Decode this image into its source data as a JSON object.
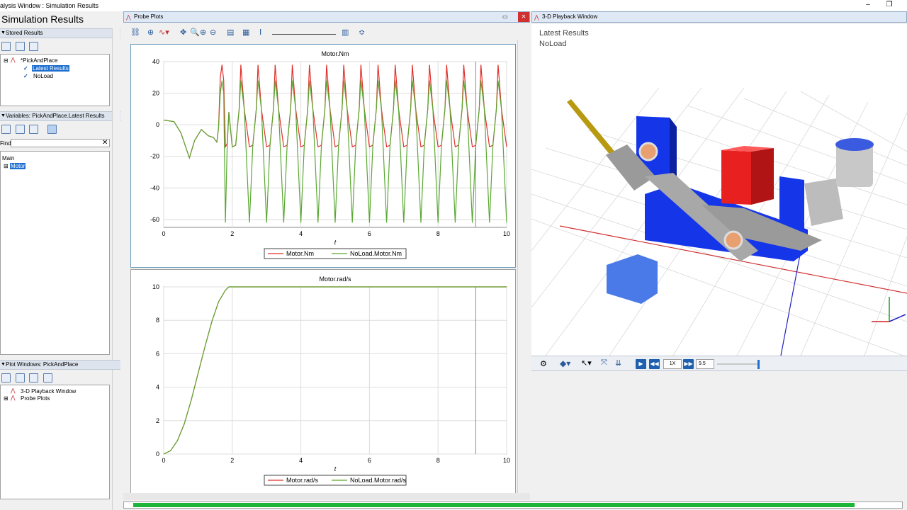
{
  "window": {
    "title": "alysis Window : Simulation Results"
  },
  "left": {
    "title": "Simulation Results",
    "stored_header": "Stored Results",
    "stored_tree": {
      "root": "*PickAndPlace",
      "items": [
        "Latest Results",
        "NoLoad"
      ]
    },
    "variables_header": "Variables: PickAndPlace.Latest Results",
    "find_label": "Find:",
    "find_value": "",
    "var_tree": {
      "root": "Main",
      "items": [
        "Motor"
      ]
    },
    "plotwin_header": "Plot Windows: PickAndPlace",
    "plotwin_tree": [
      "3-D Playback Window",
      "Probe Plots"
    ]
  },
  "probe": {
    "title": "Probe Plots"
  },
  "charts": [
    {
      "type": "line",
      "title": "Motor.Nm",
      "xlabel": "t",
      "xlim": [
        0,
        10
      ],
      "ylim": [
        -65,
        40
      ],
      "xticks": [
        0,
        2,
        4,
        6,
        8,
        10
      ],
      "yticks": [
        -60,
        -40,
        -20,
        0,
        20,
        40
      ],
      "cursor_x": 9.1,
      "series": [
        {
          "name": "Motor.Nm",
          "color": "#e0302a"
        },
        {
          "name": "NoLoad.Motor.Nm",
          "color": "#5aa832"
        }
      ]
    },
    {
      "type": "line",
      "title": "Motor.rad/s",
      "xlabel": "t",
      "xlim": [
        0,
        10
      ],
      "ylim": [
        0,
        10
      ],
      "xticks": [
        0,
        2,
        4,
        6,
        8,
        10
      ],
      "yticks": [
        0,
        2,
        4,
        6,
        8,
        10
      ],
      "cursor_x": 9.1,
      "series": [
        {
          "name": "Motor.rad/s",
          "color": "#e0302a"
        },
        {
          "name": "NoLoad.Motor.rad/s",
          "color": "#5aa832"
        }
      ]
    }
  ],
  "chart_data": [
    {
      "type": "line",
      "title": "Motor.Nm",
      "xlabel": "t",
      "xlim": [
        0,
        10
      ],
      "ylim": [
        -65,
        40
      ],
      "series": [
        {
          "name": "Motor.Nm",
          "x": [
            0,
            0.3,
            0.5,
            0.75,
            0.9,
            1.1,
            1.3,
            1.45,
            1.55,
            1.6,
            1.65,
            1.7,
            1.75,
            1.8,
            1.85,
            1.9,
            2.0,
            2.1,
            2.2,
            2.25,
            2.35,
            2.5
          ],
          "y": [
            3,
            2,
            -5,
            -21,
            -10,
            -3,
            -7,
            -8,
            -11,
            -2,
            30,
            38,
            28,
            -14,
            -12,
            8,
            -14,
            -13,
            10,
            38,
            10,
            -14
          ]
        },
        {
          "name": "NoLoad.Motor.Nm",
          "x": [
            0,
            0.3,
            0.5,
            0.75,
            0.9,
            1.1,
            1.3,
            1.45,
            1.55,
            1.6,
            1.65,
            1.7,
            1.75,
            1.8,
            1.85,
            1.9,
            2.0,
            2.1,
            2.2,
            2.25,
            2.35,
            2.5
          ],
          "y": [
            3,
            2,
            -5,
            -21,
            -10,
            -3,
            -7,
            -8,
            -11,
            -2,
            20,
            28,
            20,
            -62,
            -15,
            8,
            -14,
            -13,
            10,
            28,
            10,
            -62
          ]
        }
      ]
    },
    {
      "type": "line",
      "title": "Motor.rad/s",
      "xlabel": "t",
      "xlim": [
        0,
        10
      ],
      "ylim": [
        0,
        10
      ],
      "series": [
        {
          "name": "Motor.rad/s",
          "x": [
            0,
            0.2,
            0.4,
            0.6,
            0.8,
            1.0,
            1.2,
            1.4,
            1.6,
            1.8,
            1.9,
            2.0,
            10
          ],
          "y": [
            0,
            0.2,
            0.8,
            1.8,
            3.2,
            4.8,
            6.4,
            7.9,
            9.1,
            9.8,
            10,
            10,
            10
          ]
        },
        {
          "name": "NoLoad.Motor.rad/s",
          "x": [
            0,
            0.2,
            0.4,
            0.6,
            0.8,
            1.0,
            1.2,
            1.4,
            1.6,
            1.8,
            1.9,
            2.0,
            10
          ],
          "y": [
            0,
            0.2,
            0.8,
            1.8,
            3.2,
            4.8,
            6.4,
            7.9,
            9.1,
            9.8,
            10,
            10,
            10
          ]
        }
      ]
    }
  ],
  "view3d": {
    "title": "3-D Playback Window",
    "overlay": [
      "Latest Results",
      "NoLoad"
    ],
    "speed": "1X",
    "time": "9.5",
    "slider_position": 0.95
  },
  "progress": {
    "value": 0.96
  }
}
